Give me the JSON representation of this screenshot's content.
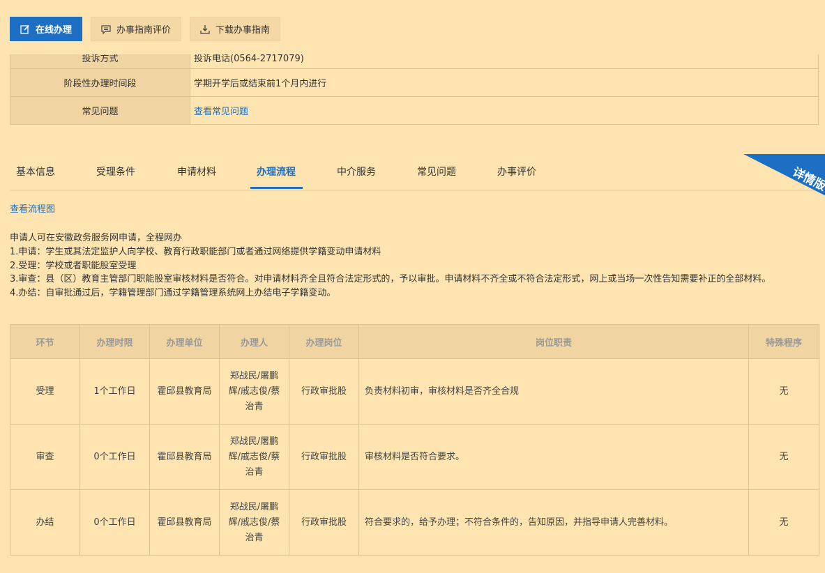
{
  "actions": {
    "online": "在线办理",
    "evaluate": "办事指南评价",
    "download": "下载办事指南"
  },
  "info": {
    "rows": [
      {
        "label": "投诉方式",
        "value": "投诉电话(0564-2717079)"
      },
      {
        "label": "阶段性办理时间段",
        "value": "学期开学后或结束前1个月内进行"
      },
      {
        "label": "常见问题",
        "value": "查看常见问题"
      }
    ]
  },
  "tabs": [
    "基本信息",
    "受理条件",
    "申请材料",
    "办理流程",
    "中介服务",
    "常见问题",
    "办事评价"
  ],
  "active_tab": "办理流程",
  "ribbon": "详情版",
  "flow_link": "查看流程图",
  "description": [
    "申请人可在安徽政务服务网申请，全程网办",
    "1.申请：学生或其法定监护人向学校、教育行政职能部门或者通过网络提供学籍变动申请材料",
    "2.受理：学校或者职能股室受理",
    "3.审查：县（区）教育主管部门职能股室审核材料是否符合。对申请材料齐全且符合法定形式的，予以审批。申请材料不齐全或不符合法定形式，网上或当场一次性告知需要补正的全部材料。",
    "4.办结：自审批通过后，学籍管理部门通过学籍管理系统网上办结电子学籍变动。"
  ],
  "process": {
    "headers": [
      "环节",
      "办理时限",
      "办理单位",
      "办理人",
      "办理岗位",
      "岗位职责",
      "特殊程序"
    ],
    "rows": [
      {
        "step": "受理",
        "limit": "1个工作日",
        "unit": "霍邱县教育局",
        "person": "郑战民/屠鹏辉/戚志俊/蔡治青",
        "post": "行政审批股",
        "duty": "负责材料初审，审核材料是否齐全合规",
        "special": "无"
      },
      {
        "step": "审查",
        "limit": "0个工作日",
        "unit": "霍邱县教育局",
        "person": "郑战民/屠鹏辉/戚志俊/蔡治青",
        "post": "行政审批股",
        "duty": "审核材料是否符合要求。",
        "special": "无"
      },
      {
        "step": "办结",
        "limit": "0个工作日",
        "unit": "霍邱县教育局",
        "person": "郑战民/屠鹏辉/戚志俊/蔡治青",
        "post": "行政审批股",
        "duty": "符合要求的，给予办理；不符合条件的，告知原因，并指导申请人完善材料。",
        "special": "无"
      }
    ]
  },
  "colors": {
    "background": "#fde4b0",
    "primary": "#1d6fc4",
    "label_bg": "#f0d5a3",
    "border": "#dcc392"
  },
  "icons": {
    "online": "edit-icon",
    "evaluate": "comment-icon",
    "download": "download-icon"
  }
}
